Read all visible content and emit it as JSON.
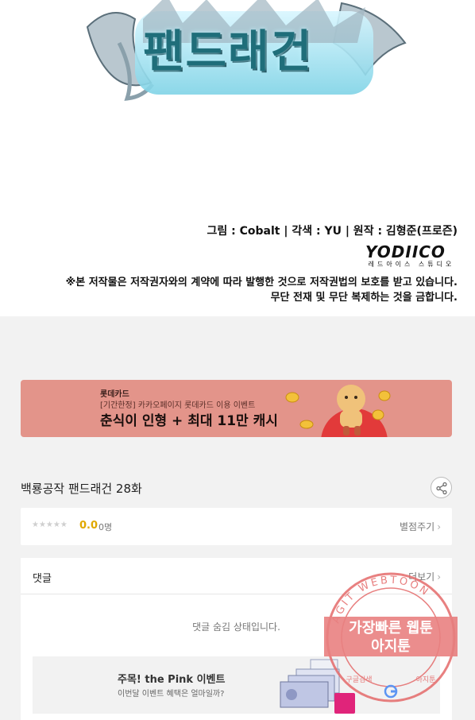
{
  "comic": {
    "title": "팬드래건",
    "credits": "그림 : Cobalt  |  각색 : YU  |  원작 : 김형준(프로즌)",
    "studio_logo": "YODIICO",
    "studio_sub": "레드아이스 스튜디오",
    "notice_line1": "※본 저작물은 저작권자와의 계약에 따라 발행한 것으로 저작권법의 보호를 받고 있습니다.",
    "notice_line2": "무단 전재 및 무단 복제하는 것을 금합니다."
  },
  "ad": {
    "brand": "롯데카드",
    "subtitle": "[기간한정] 카카오페이지 롯데카드 이용 이벤트",
    "headline": "춘식이 인형 + 최대 11만 캐시"
  },
  "episode": {
    "title": "백룡공작 팬드래건 28화",
    "share_icon": "share-icon"
  },
  "rating": {
    "stars": "★★★★★",
    "value": "0.0",
    "count": "0명",
    "rate_label": "별점주기",
    "chevron": "›"
  },
  "comments": {
    "title": "댓글",
    "more_label": "더보기",
    "chevron": "›",
    "hidden_message": "댓글 숨김 상태입니다."
  },
  "event": {
    "title": "주목! the Pink 이벤트",
    "subtitle": "이번달 이벤트 혜택은 얼마일까?"
  },
  "watermark": {
    "ring_text": "AGIT WEBTOON",
    "main_line1": "가장빠른 웹툰",
    "main_line2": "아지툰",
    "bottom_left": "구글검색",
    "bottom_right": "아지툰"
  },
  "colors": {
    "ad_background": "#e3948a",
    "rating_accent": "#e0a800",
    "watermark": "#e46a6a",
    "page_background": "#f2f2f2"
  }
}
